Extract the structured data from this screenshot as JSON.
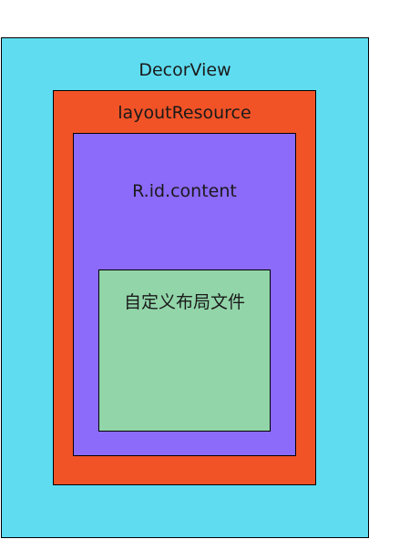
{
  "diagram": {
    "decor_view": {
      "label": "DecorView",
      "color": "#5fdcf0"
    },
    "layout_resource": {
      "label": "layoutResource",
      "color": "#f15327"
    },
    "content": {
      "label": "R.id.content",
      "color": "#8c6afa"
    },
    "custom_layout": {
      "label": "自定义布局文件",
      "color": "#92d5a9"
    }
  }
}
